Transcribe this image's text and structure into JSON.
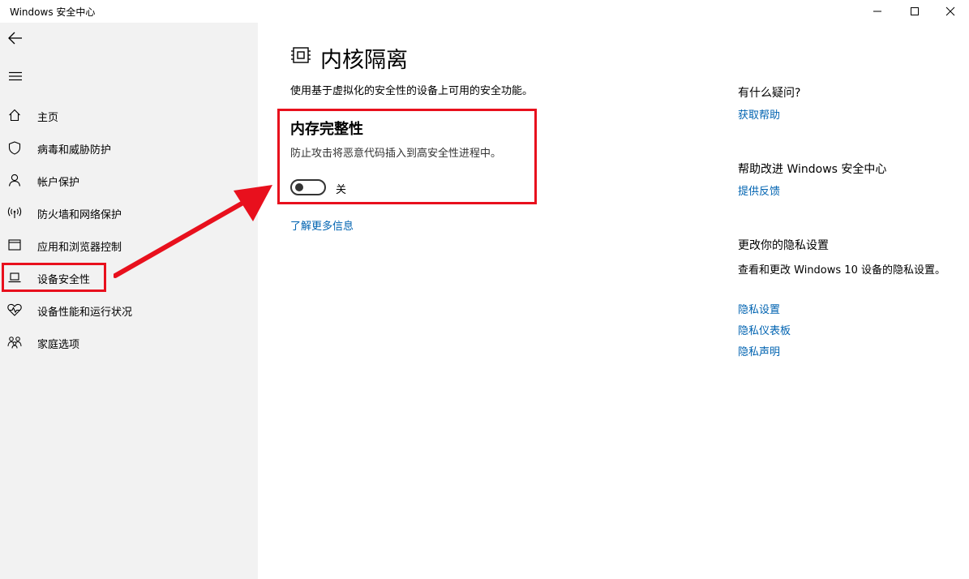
{
  "window": {
    "title": "Windows 安全中心"
  },
  "sidebar": {
    "items": [
      {
        "label": "主页",
        "icon": "home-icon"
      },
      {
        "label": "病毒和威胁防护",
        "icon": "shield-icon"
      },
      {
        "label": "帐户保护",
        "icon": "person-icon"
      },
      {
        "label": "防火墙和网络保护",
        "icon": "wifi-signal-icon"
      },
      {
        "label": "应用和浏览器控制",
        "icon": "browser-window-icon"
      },
      {
        "label": "设备安全性",
        "icon": "laptop-icon"
      },
      {
        "label": "设备性能和运行状况",
        "icon": "heart-pulse-icon"
      },
      {
        "label": "家庭选项",
        "icon": "family-icon"
      }
    ],
    "active_index": 5
  },
  "main": {
    "title": "内核隔离",
    "description": "使用基于虚拟化的安全性的设备上可用的安全功能。",
    "memory_integrity": {
      "title": "内存完整性",
      "description": "防止攻击将恶意代码插入到高安全性进程中。",
      "toggle_state": "关"
    },
    "learn_more": "了解更多信息"
  },
  "aside": {
    "question_heading": "有什么疑问?",
    "get_help": "获取帮助",
    "improve_heading": "帮助改进 Windows 安全中心",
    "feedback": "提供反馈",
    "privacy_heading": "更改你的隐私设置",
    "privacy_text": "查看和更改 Windows 10 设备的隐私设置。",
    "privacy_settings": "隐私设置",
    "privacy_dashboard": "隐私仪表板",
    "privacy_statement": "隐私声明"
  },
  "colors": {
    "link": "#0063b1",
    "highlight": "#e8101d",
    "sidebar_bg": "#f2f2f2"
  }
}
